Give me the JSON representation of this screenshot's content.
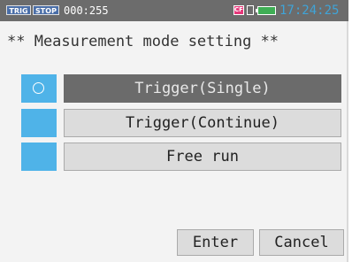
{
  "status_bar": {
    "trig_badge": "TRIG",
    "stop_badge": "STOP",
    "counter": "000:255",
    "cf_icon": "cf-card-icon",
    "cf_label": "CF",
    "battery_icon": "battery-icon",
    "time": "17:24:25"
  },
  "title": "** Measurement mode setting **",
  "options": [
    {
      "label": "Trigger(Single)",
      "selected": true
    },
    {
      "label": "Trigger(Continue)",
      "selected": false
    },
    {
      "label": "Free run",
      "selected": false
    }
  ],
  "buttons": {
    "enter": "Enter",
    "cancel": "Cancel"
  },
  "colors": {
    "status_bar_bg": "#6c6c6c",
    "clock": "#3fa4d8",
    "radio_box": "#4fb3e8",
    "selected_option_bg": "#6b6b6b",
    "option_bg": "#dcdcdc",
    "battery": "#3fae55",
    "cf_icon": "#e6377a"
  }
}
